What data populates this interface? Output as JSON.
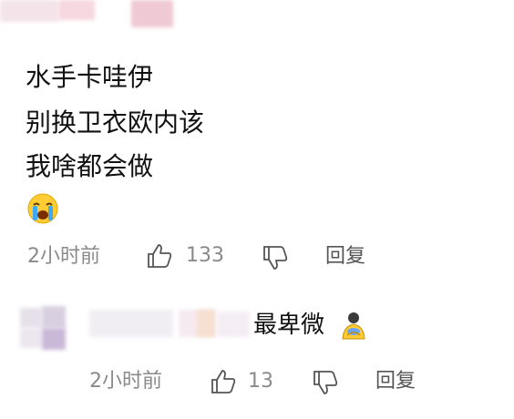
{
  "comment": {
    "lines": [
      "水手卡哇伊",
      "别换卫衣欧内该",
      "我啥都会做"
    ],
    "emoji_icon": "crying-face-icon",
    "time": "2小时前",
    "likes": "133",
    "reply_label": "回复"
  },
  "reply": {
    "text": "最卑微",
    "emoji_icon": "kneeling-figure-icon",
    "time": "2小时前",
    "likes": "13",
    "reply_label": "回复"
  },
  "colors": {
    "text": "#111111",
    "meta": "#8a8a8a",
    "blur_pink": "#f6d3dc",
    "blur_purple": "#c9b8d8"
  }
}
